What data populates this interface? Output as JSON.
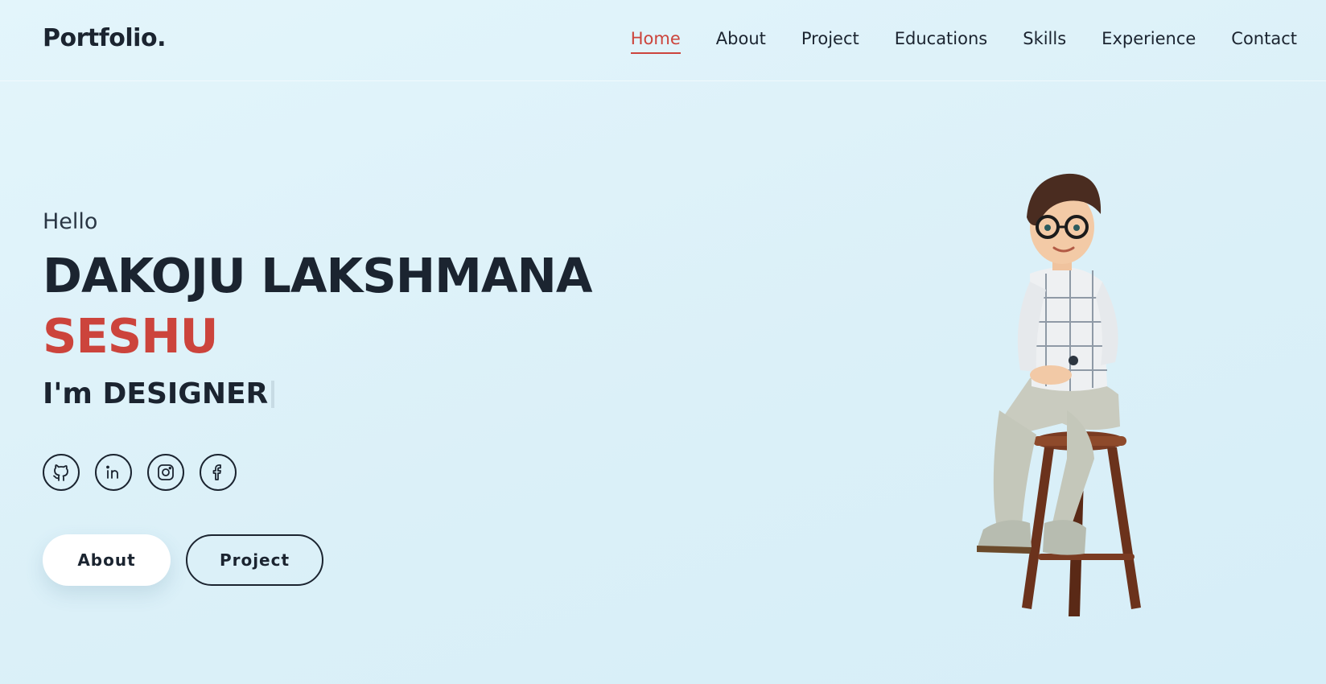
{
  "header": {
    "logo": "Portfolio.",
    "nav": [
      "Home",
      "About",
      "Project",
      "Educations",
      "Skills",
      "Experience",
      "Contact"
    ],
    "active_nav": "Home"
  },
  "hero": {
    "greeting": "Hello",
    "name_line1": "DAKOJU LAKSHMANA",
    "name_line2": "SESHU",
    "role_prefix": "I'm",
    "role_word": "DESIGNER",
    "socials": [
      "github-icon",
      "linkedin-icon",
      "instagram-icon",
      "facebook-icon"
    ],
    "buttons": {
      "about": "About",
      "project": "Project"
    }
  },
  "colors": {
    "accent": "#cc443c",
    "text": "#1b2430",
    "background": "#dcf1f9"
  }
}
